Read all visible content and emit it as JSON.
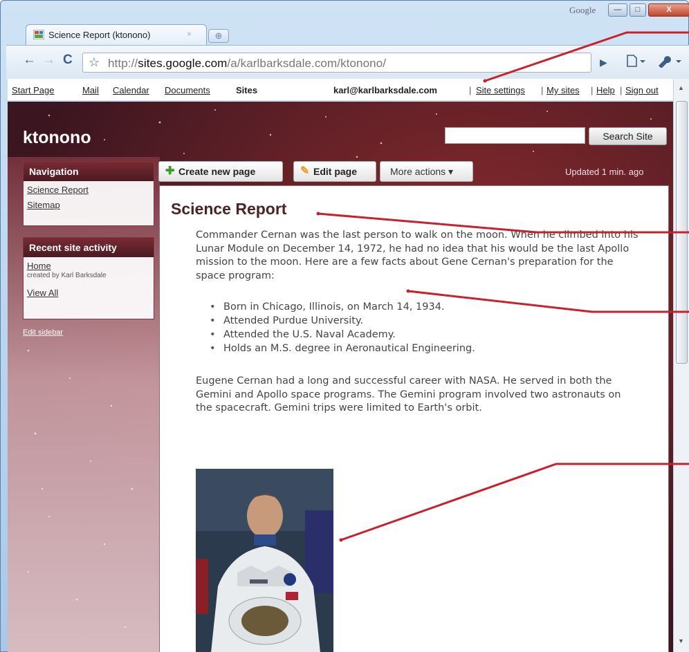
{
  "window": {
    "brand": "Google",
    "min_label": "—",
    "max_label": "□",
    "close_label": "X"
  },
  "tab": {
    "title": "Science Report (ktonono)",
    "close": "×",
    "new_tab": "⊕"
  },
  "toolbar": {
    "back": "←",
    "forward": "→",
    "reload": "C",
    "star": "☆",
    "url_prefix": "http://",
    "url_host": "sites.google.com",
    "url_path": "/a/karlbarksdale.com/ktonono/",
    "go": "▶",
    "page_menu": "🗋▾",
    "wrench_menu": "🔧▾"
  },
  "gbar": {
    "links": [
      "Start Page",
      "Mail",
      "Calendar",
      "Documents",
      "Sites"
    ],
    "user": "karl@karlbarksdale.com",
    "right_links": [
      "Site settings",
      "My sites",
      "Help",
      "Sign out"
    ],
    "separator": "|"
  },
  "site": {
    "title": "ktonono",
    "search_placeholder": "",
    "search_button": "Search Site",
    "navigation": {
      "heading": "Navigation",
      "items": [
        "Science Report",
        "Sitemap"
      ]
    },
    "recent": {
      "heading": "Recent site activity",
      "item": "Home",
      "item_sub": "created by Karl Barksdale",
      "view_all": "View All"
    },
    "edit_sidebar": "Edit sidebar",
    "actions": {
      "create": "Create new page",
      "edit": "Edit page",
      "more": "More actions ▾"
    },
    "updated": "Updated 1 min. ago"
  },
  "page": {
    "title": "Science Report",
    "paragraph1": "Commander Cernan was the last person to walk on the moon.  When he climbed into his Lunar Module on December 14, 1972, he had no idea that his would be the last Apollo mission to the moon.  Here are a few facts about Gene Cernan's preparation for the space program:",
    "facts": [
      "Born in Chicago, Illinois, on March 14, 1934.",
      "Attended Purdue University.",
      "Attended the U.S. Naval Academy.",
      "Holds an M.S. degree in Aeronautical Engineering."
    ],
    "paragraph2": "Eugene Cernan had a long and successful career with NASA.  He served in both the Gemini and Apollo space programs.  The Gemini program involved two astronauts on the spacecraft.  Gemini trips were limited to Earth's orbit."
  },
  "colors": {
    "callout": "#c8202c",
    "site_dark": "#4a1a22",
    "title": "#4a2328"
  },
  "icons": [
    "back-icon",
    "forward-icon",
    "reload-icon",
    "star-icon",
    "go-icon",
    "page-icon",
    "wrench-icon",
    "plus-icon",
    "pencil-icon",
    "chevron-down-icon"
  ]
}
